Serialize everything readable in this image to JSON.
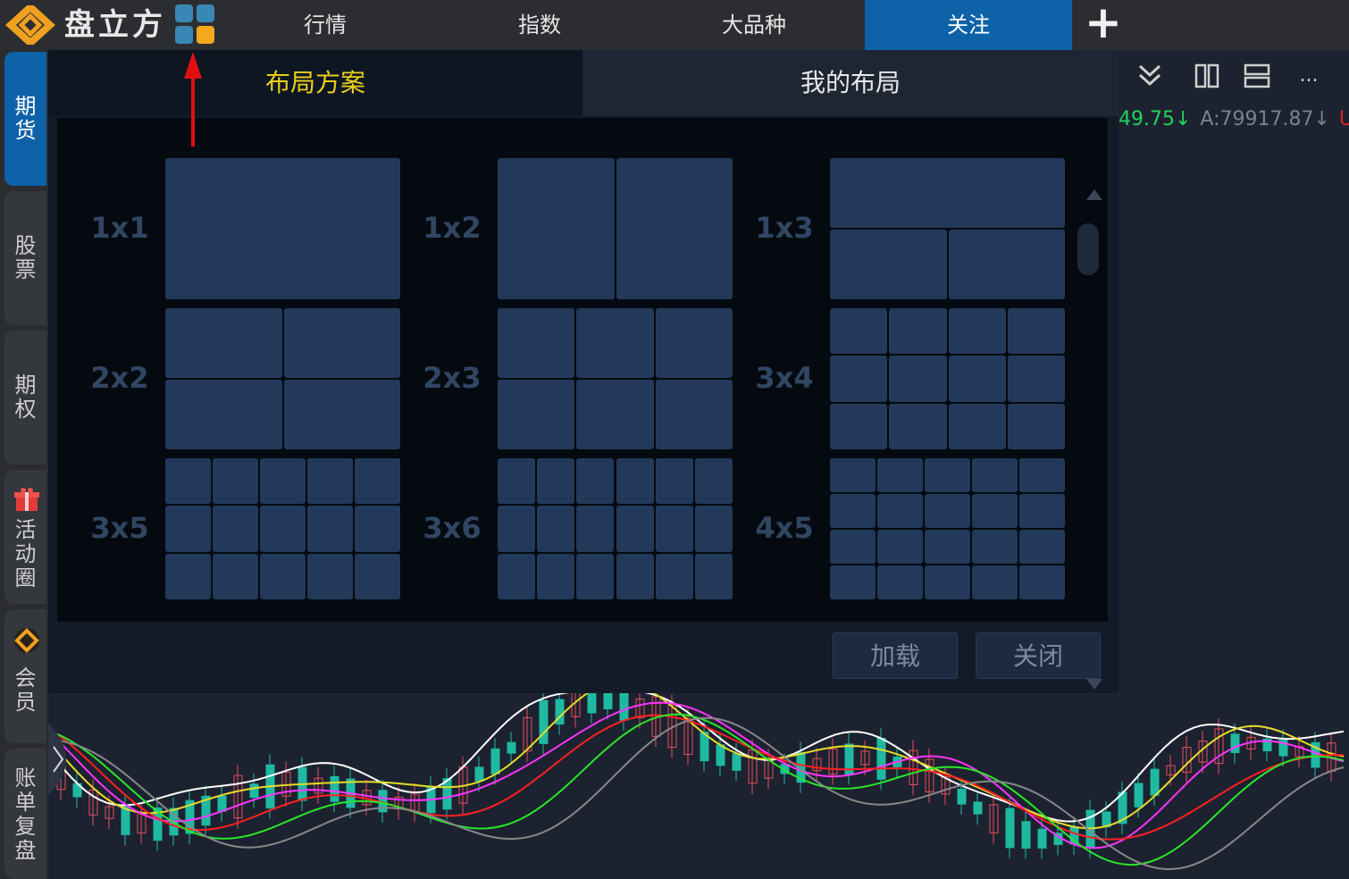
{
  "app": {
    "name": "盘立方",
    "accent": "#0e62a8",
    "brand_orange": "#f0a020"
  },
  "nav": {
    "tabs": [
      {
        "label": "行情"
      },
      {
        "label": "指数"
      },
      {
        "label": "大品种"
      },
      {
        "label": "关注",
        "active": true
      }
    ],
    "add_icon": "plus-icon",
    "layout_icon": "grid-layout-icon"
  },
  "sidebar": {
    "items": [
      {
        "label": "期货",
        "active": true
      },
      {
        "label": "股票"
      },
      {
        "label": "期权"
      },
      {
        "label": "活动圈",
        "icon": "gift-icon"
      },
      {
        "label": "会员",
        "icon": "brand-logo-icon"
      },
      {
        "label": "账单复盘"
      }
    ]
  },
  "chart_toolbar": {
    "icons": [
      "collapse-down-icon",
      "split-columns-icon",
      "split-rows-icon",
      "more-icon"
    ],
    "more_label": "..."
  },
  "ticker": {
    "last": "49.75↓",
    "ask": "A:79917.87↓",
    "u": "U:"
  },
  "dialog": {
    "tabs": [
      {
        "label": "布局方案",
        "active": true
      },
      {
        "label": "我的布局"
      }
    ],
    "layouts": [
      {
        "label": "1x1",
        "rows": 1,
        "cols": 1
      },
      {
        "label": "1x2",
        "rows": 1,
        "cols": 2
      },
      {
        "label": "1x3",
        "rows": 2,
        "cols": 2,
        "top_span": true
      },
      {
        "label": "2x2",
        "rows": 2,
        "cols": 2
      },
      {
        "label": "2x3",
        "rows": 2,
        "cols": 3
      },
      {
        "label": "3x4",
        "rows": 3,
        "cols": 4
      },
      {
        "label": "3x5",
        "rows": 3,
        "cols": 5
      },
      {
        "label": "3x6",
        "rows": 3,
        "cols": 6
      },
      {
        "label": "4x5",
        "rows": 4,
        "cols": 5
      }
    ],
    "buttons": {
      "load": "加载",
      "close": "关闭"
    }
  },
  "chart_colors": {
    "up": "#e84f5b",
    "down": "#1fb9a2",
    "ma": [
      "#ffffff",
      "#e6dc2a",
      "#ff33ff",
      "#ff2020",
      "#29e629",
      "#888888"
    ]
  }
}
